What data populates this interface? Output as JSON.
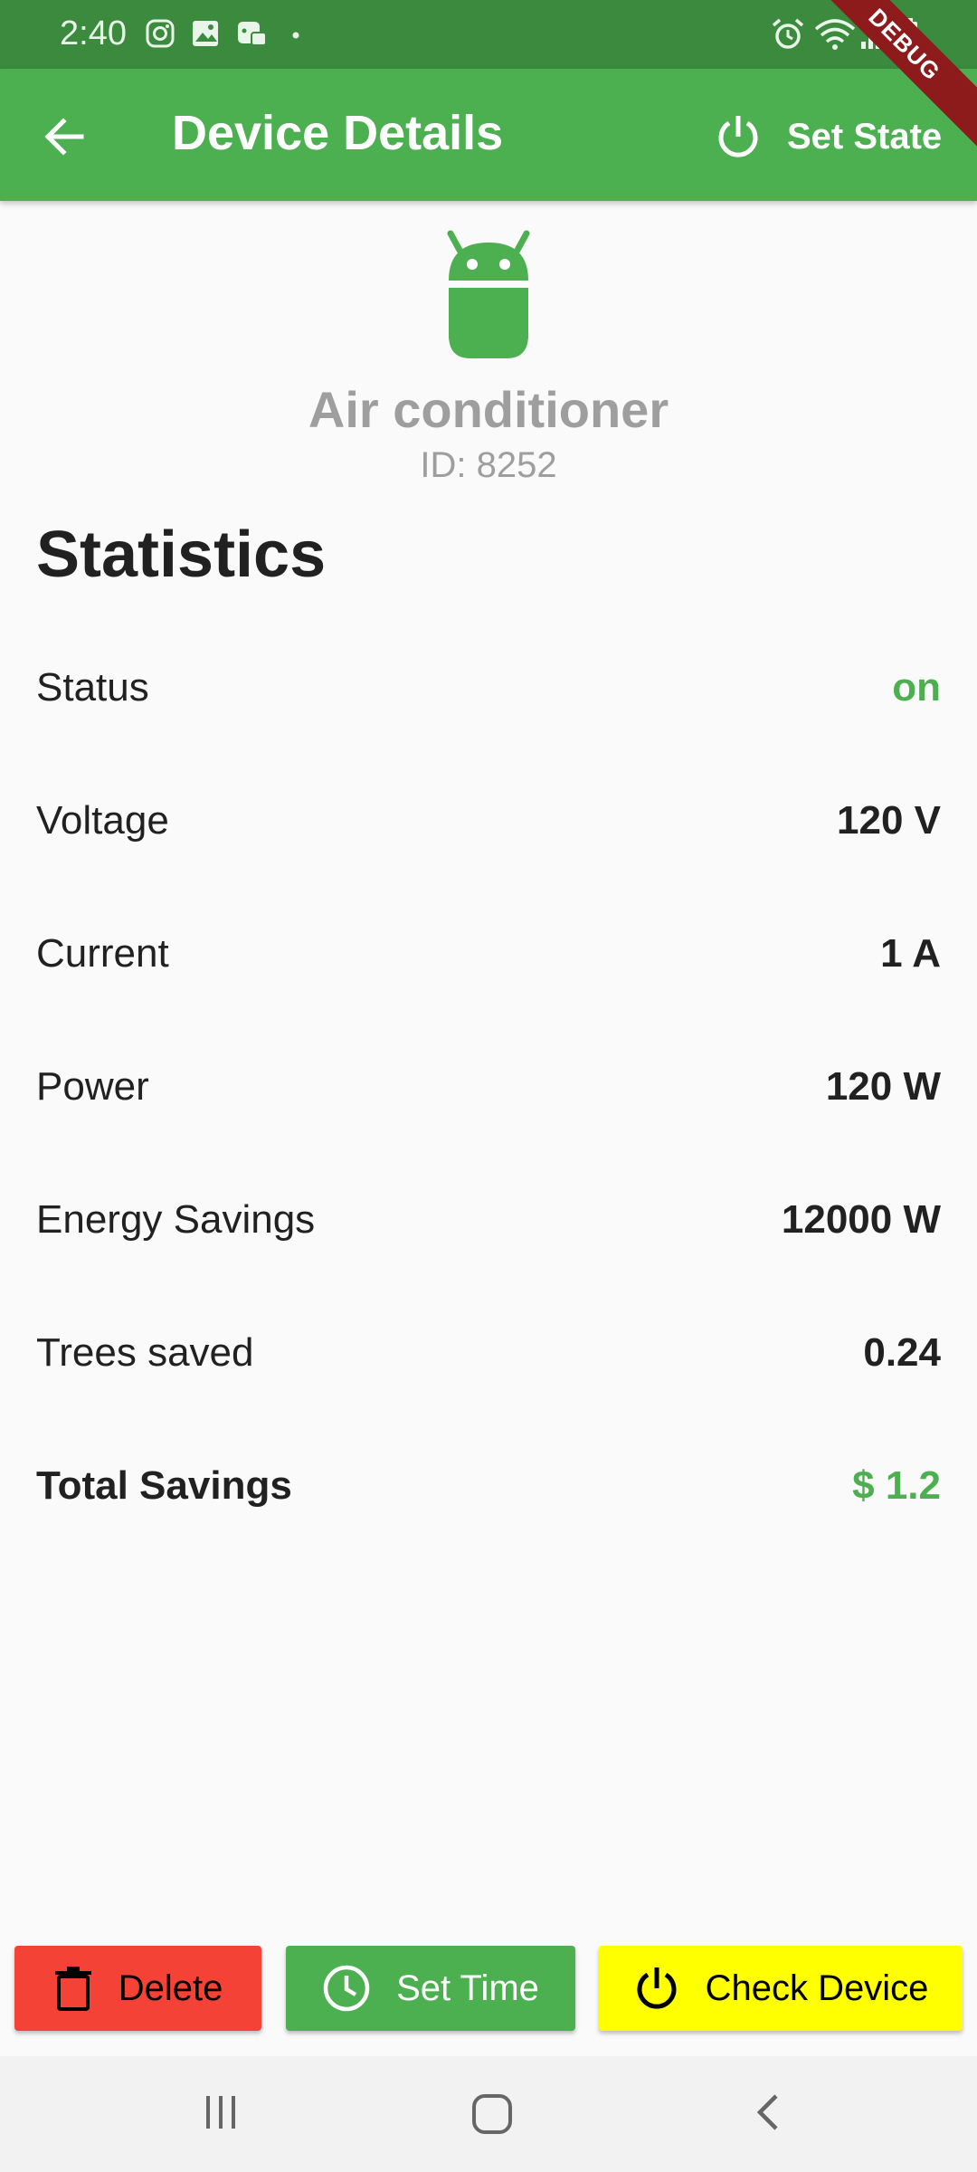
{
  "status_bar": {
    "time": "2:40",
    "left_icons": [
      "instagram-icon",
      "gallery-icon",
      "game-icon",
      "dot-icon"
    ],
    "right_icons": [
      "alarm-icon",
      "wifi-icon",
      "signal-icon",
      "battery-icon"
    ],
    "debug_banner": "DEBUG"
  },
  "app_bar": {
    "title": "Device Details",
    "back_icon": "arrow-back-icon",
    "set_state_label": "Set State",
    "set_state_icon": "power-icon",
    "color": "#4caf50"
  },
  "device": {
    "icon": "android-icon",
    "name": "Air conditioner",
    "id_text": "ID: 8252"
  },
  "statistics": {
    "title": "Statistics",
    "rows": [
      {
        "label": "Status",
        "value": "on"
      },
      {
        "label": "Voltage",
        "value": "120 V"
      },
      {
        "label": "Current",
        "value": "1 A"
      },
      {
        "label": "Power",
        "value": "120 W"
      },
      {
        "label": "Energy Savings",
        "value": "12000 W"
      },
      {
        "label": "Trees saved",
        "value": "0.24"
      },
      {
        "label": "Total Savings",
        "value": "$ 1.2"
      }
    ]
  },
  "actions": {
    "delete_label": "Delete",
    "delete_icon": "trash-icon",
    "set_time_label": "Set Time",
    "set_time_icon": "clock-icon",
    "check_device_label": "Check Device",
    "check_device_icon": "power-icon",
    "colors": {
      "delete": "#f44336",
      "set_time": "#4caf50",
      "check_device": "#ffff00"
    }
  },
  "nav_bar": {
    "icons": [
      "recents-icon",
      "home-icon",
      "back-icon"
    ]
  }
}
